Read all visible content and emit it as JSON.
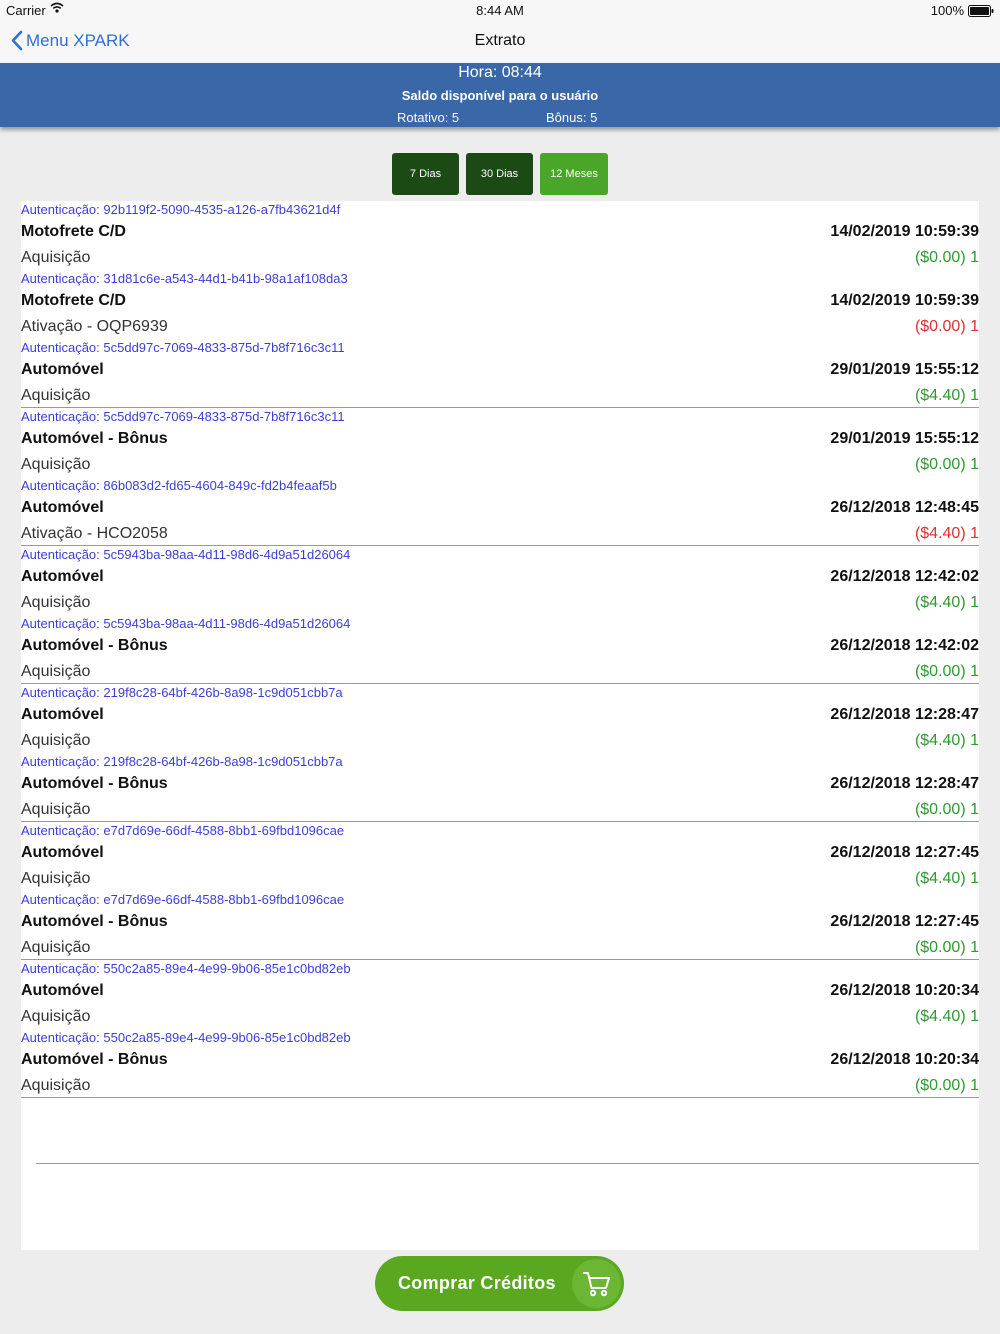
{
  "status": {
    "carrier": "Carrier",
    "time": "8:44 AM",
    "battery": "100%"
  },
  "nav": {
    "back_label": "Menu XPARK",
    "title": "Extrato"
  },
  "header": {
    "hora": "Hora: 08:44",
    "saldo_title": "Saldo disponível para o usuário",
    "rotativo": "Rotativo: 5",
    "bonus": "Bônus: 5"
  },
  "filters": [
    "7 Dias",
    "30 Dias",
    "12 Meses"
  ],
  "records": [
    {
      "auth": "Autenticação: 92b119f2-5090-4535-a126-a7fb43621d4f",
      "name": "Motofrete C/D",
      "datetime": "14/02/2019 10:59:39",
      "desc": "Aquisição",
      "amount": "($0.00) 1",
      "color": "#2f9a2f"
    },
    {
      "auth": "Autenticação: 31d81c6e-a543-44d1-b41b-98a1af108da3",
      "name": "Motofrete C/D",
      "datetime": "14/02/2019 10:59:39",
      "desc": "Ativação - OQP6939",
      "amount": "($0.00) 1",
      "color": "#e03030"
    },
    {
      "auth": "Autenticação: 5c5dd97c-7069-4833-875d-7b8f716c3c11",
      "name": "Automóvel",
      "datetime": "29/01/2019 15:55:12",
      "desc": "Aquisição",
      "amount": "($4.40) 1",
      "color": "#2f9a2f"
    },
    {
      "auth": "Autenticação: 5c5dd97c-7069-4833-875d-7b8f716c3c11",
      "name": "Automóvel - Bônus",
      "datetime": "29/01/2019 15:55:12",
      "desc": "Aquisição",
      "amount": "($0.00) 1",
      "color": "#2f9a2f"
    },
    {
      "auth": "Autenticação: 86b083d2-fd65-4604-849c-fd2b4feaaf5b",
      "name": "Automóvel",
      "datetime": "26/12/2018 12:48:45",
      "desc": "Ativação - HCO2058",
      "amount": "($4.40) 1",
      "color": "#e03030"
    },
    {
      "auth": "Autenticação: 5c5943ba-98aa-4d11-98d6-4d9a51d26064",
      "name": "Automóvel",
      "datetime": "26/12/2018 12:42:02",
      "desc": "Aquisição",
      "amount": "($4.40) 1",
      "color": "#2f9a2f"
    },
    {
      "auth": "Autenticação: 5c5943ba-98aa-4d11-98d6-4d9a51d26064",
      "name": "Automóvel - Bônus",
      "datetime": "26/12/2018 12:42:02",
      "desc": "Aquisição",
      "amount": "($0.00) 1",
      "color": "#2f9a2f"
    },
    {
      "auth": "Autenticação: 219f8c28-64bf-426b-8a98-1c9d051cbb7a",
      "name": "Automóvel",
      "datetime": "26/12/2018 12:28:47",
      "desc": "Aquisição",
      "amount": "($4.40) 1",
      "color": "#2f9a2f"
    },
    {
      "auth": "Autenticação: 219f8c28-64bf-426b-8a98-1c9d051cbb7a",
      "name": "Automóvel - Bônus",
      "datetime": "26/12/2018 12:28:47",
      "desc": "Aquisição",
      "amount": "($0.00) 1",
      "color": "#2f9a2f"
    },
    {
      "auth": "Autenticação: e7d7d69e-66df-4588-8bb1-69fbd1096cae",
      "name": "Automóvel",
      "datetime": "26/12/2018 12:27:45",
      "desc": "Aquisição",
      "amount": "($4.40) 1",
      "color": "#2f9a2f"
    },
    {
      "auth": "Autenticação: e7d7d69e-66df-4588-8bb1-69fbd1096cae",
      "name": "Automóvel - Bônus",
      "datetime": "26/12/2018 12:27:45",
      "desc": "Aquisição",
      "amount": "($0.00) 1",
      "color": "#2f9a2f"
    },
    {
      "auth": "Autenticação: 550c2a85-89e4-4e99-9b06-85e1c0bd82eb",
      "name": "Automóvel",
      "datetime": "26/12/2018 10:20:34",
      "desc": "Aquisição",
      "amount": "($4.40) 1",
      "color": "#2f9a2f"
    },
    {
      "auth": "Autenticação: 550c2a85-89e4-4e99-9b06-85e1c0bd82eb",
      "name": "Automóvel - Bônus",
      "datetime": "26/12/2018 10:20:34",
      "desc": "Aquisição",
      "amount": "($0.00) 1",
      "color": "#2f9a2f"
    }
  ],
  "buy_button": {
    "label": "Comprar Créditos",
    "icon": "cart-icon"
  }
}
